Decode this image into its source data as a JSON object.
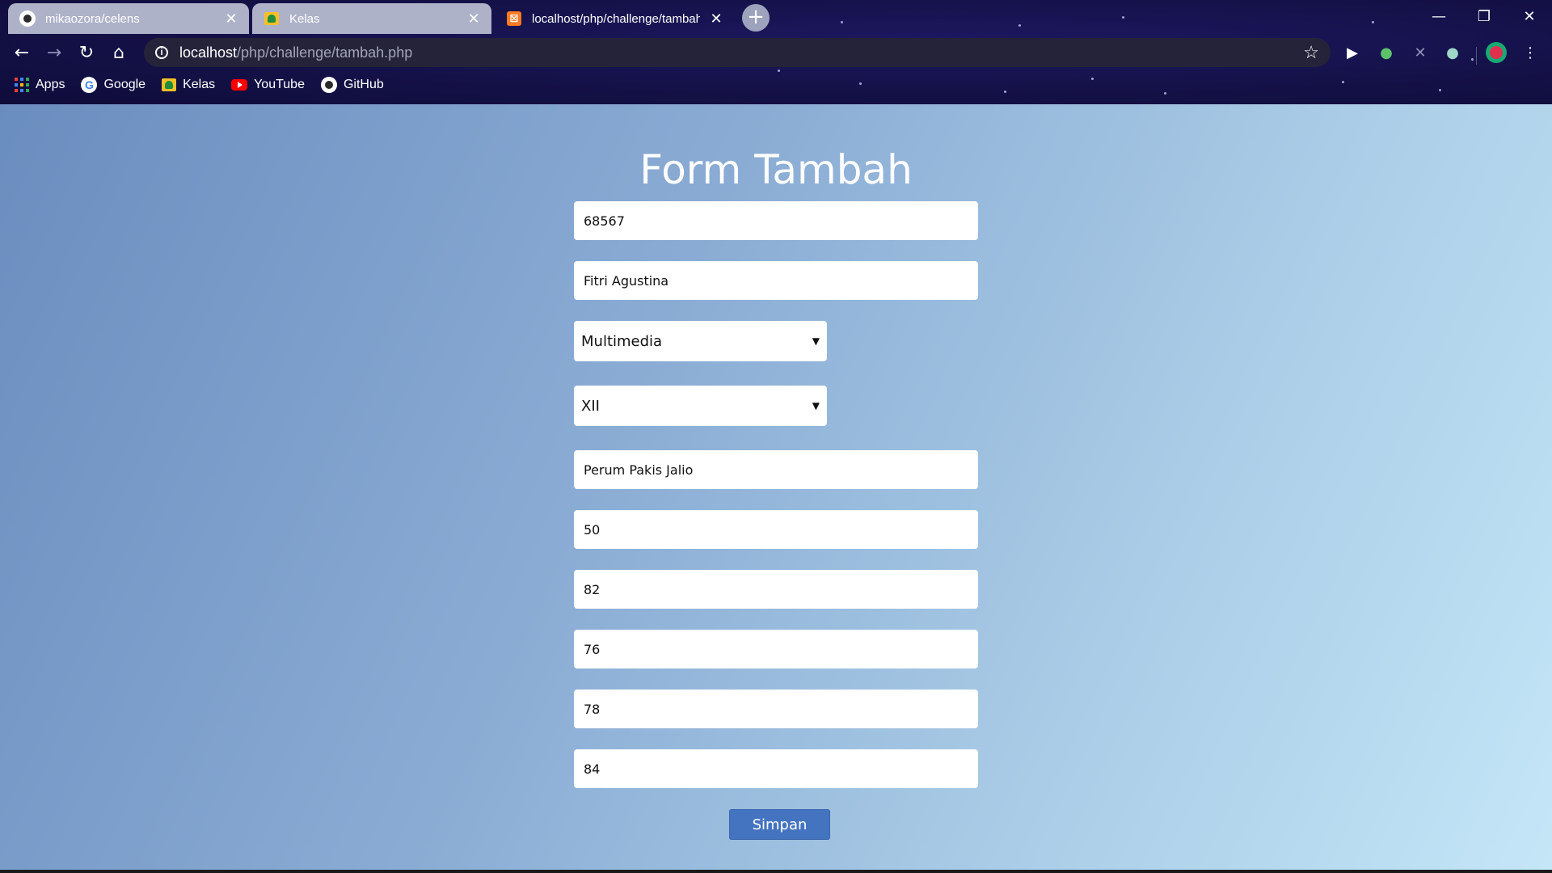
{
  "browser": {
    "tabs": [
      {
        "title": "mikaozora/celens",
        "icon": "github-icon",
        "active": false
      },
      {
        "title": "Kelas",
        "icon": "google-classroom-icon",
        "active": false
      },
      {
        "title": "localhost/php/challenge/tambah",
        "icon": "xampp-icon",
        "active": true
      }
    ],
    "new_tab_label": "+",
    "url_host": "localhost",
    "url_path": "/php/challenge/tambah.php",
    "bookmarks": [
      "Apps",
      "Google",
      "Kelas",
      "YouTube",
      "GitHub"
    ]
  },
  "form": {
    "title": "Form Tambah",
    "fields": [
      "68567",
      "Fitri Agustina",
      "Perum Pakis Jalio",
      "50",
      "82",
      "76",
      "78",
      "84"
    ],
    "selects": [
      "Multimedia",
      "XII"
    ],
    "submit_label": "Simpan"
  },
  "colors": {
    "chrome_bg": "#141148",
    "button_bg": "#4474c0",
    "gradient_start": "#6a8dbf",
    "gradient_end": "#c4e6f7"
  }
}
